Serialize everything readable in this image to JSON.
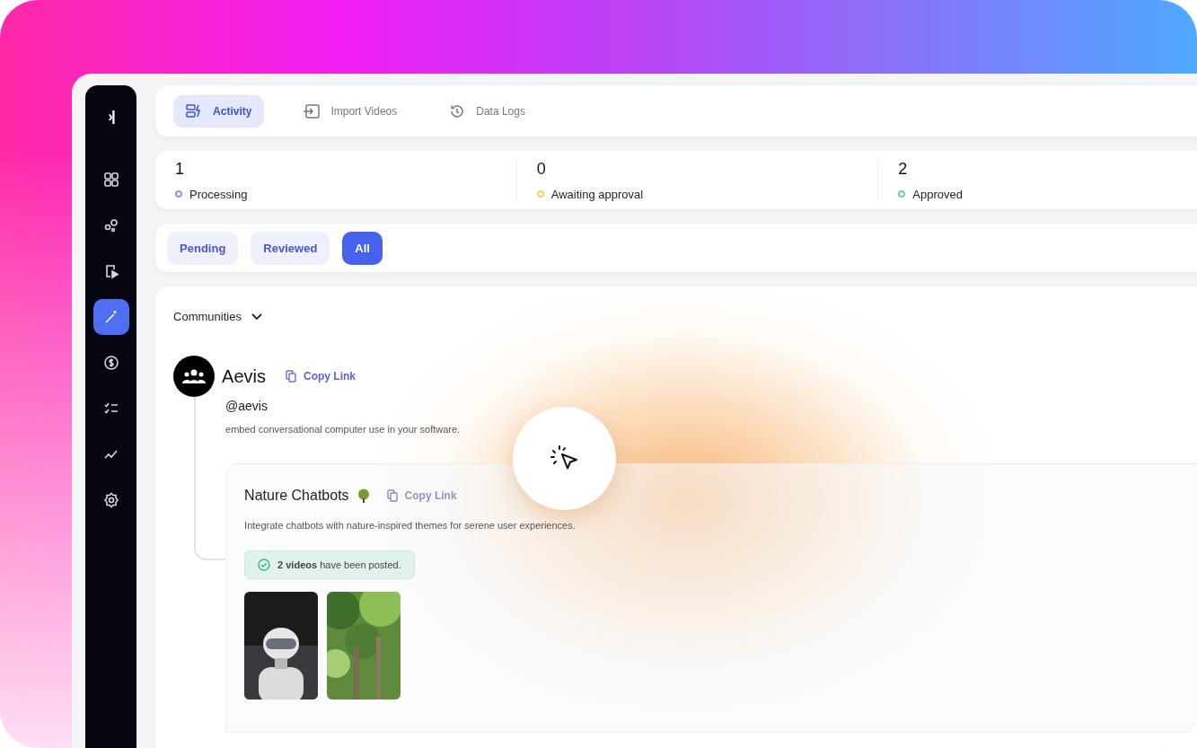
{
  "sidebar": {
    "toggle": "›|",
    "items": [
      {
        "selected": false
      },
      {
        "selected": false
      },
      {
        "selected": false
      },
      {
        "selected": true
      },
      {
        "selected": false
      },
      {
        "selected": false
      },
      {
        "selected": false
      },
      {
        "selected": false
      }
    ]
  },
  "tabs": [
    {
      "label": "Activity",
      "selected": true
    },
    {
      "label": "Import Videos",
      "selected": false
    },
    {
      "label": "Data Logs",
      "selected": false
    }
  ],
  "stats": [
    {
      "value": "1",
      "label": "Processing",
      "color": "#8e95e0"
    },
    {
      "value": "0",
      "label": "Awaiting approval",
      "color": "#f5d36b"
    },
    {
      "value": "2",
      "label": "Approved",
      "color": "#6fd1b0"
    }
  ],
  "filters": [
    {
      "label": "Pending",
      "selected": false
    },
    {
      "label": "Reviewed",
      "selected": false
    },
    {
      "label": "All",
      "selected": true
    }
  ],
  "communities": {
    "dropdown_label": "Communities",
    "name": "Aevis",
    "copy_link": "Copy Link",
    "handle": "@aevis",
    "description": "embed conversational computer use in your software.",
    "project": {
      "title": "Nature Chatbots",
      "copy_link": "Copy Link",
      "description": "Integrate chatbots with nature-inspired themes for serene user experiences.",
      "notice": "**2 videos** have been posted."
    }
  }
}
